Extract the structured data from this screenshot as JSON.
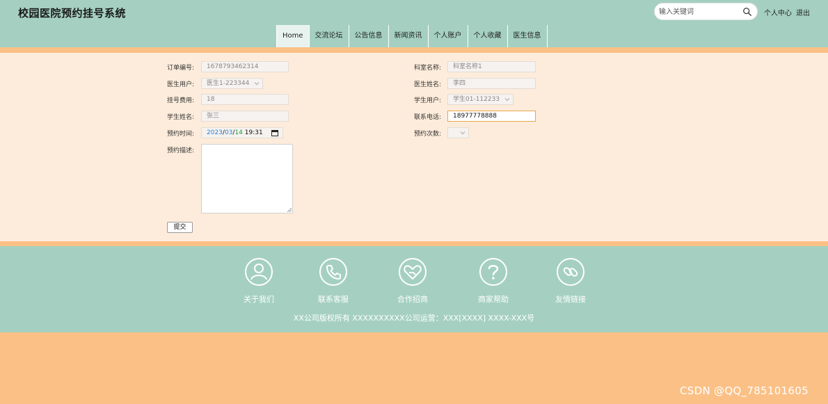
{
  "header": {
    "site_title": "校园医院预约挂号系统",
    "search_placeholder": "输入关键词",
    "personal_center": "个人中心",
    "logout": "退出"
  },
  "nav": {
    "items": [
      {
        "label": "Home",
        "active": true
      },
      {
        "label": "交流论坛"
      },
      {
        "label": "公告信息"
      },
      {
        "label": "新闻资讯"
      },
      {
        "label": "个人账户"
      },
      {
        "label": "个人收藏"
      },
      {
        "label": "医生信息"
      }
    ]
  },
  "form": {
    "order_no_label": "订单编号:",
    "order_no_value": "1678793462314",
    "doctor_user_label": "医生用户:",
    "doctor_user_value": "医生1-223344",
    "fee_label": "挂号费用:",
    "fee_value": "18",
    "student_name_label": "学生姓名:",
    "student_name_value": "张三",
    "appt_time_label": "预约时间:",
    "appt_year": "2023",
    "appt_month": "03",
    "appt_day": "14",
    "appt_clock": "19:31",
    "desc_label": "预约描述:",
    "dept_label": "科室名称:",
    "dept_value": "科室名称1",
    "doctor_name_label": "医生姓名:",
    "doctor_name_value": "李四",
    "student_user_label": "学生用户:",
    "student_user_value": "学生01-112233",
    "phone_label": "联系电话:",
    "phone_value": "18977778888",
    "count_label": "预约次数:",
    "count_value": "",
    "submit_label": "提交"
  },
  "footer": {
    "links": [
      {
        "label": "关于我们",
        "icon": "user-icon"
      },
      {
        "label": "联系客服",
        "icon": "phone-icon"
      },
      {
        "label": "合作招商",
        "icon": "handshake-heart-icon"
      },
      {
        "label": "商家帮助",
        "icon": "question-icon"
      },
      {
        "label": "友情链接",
        "icon": "link-icon"
      }
    ],
    "copyright": "XX公司版权所有 XXXXXXXXXX公司运营：XXX[XXXX] XXXX-XXX号"
  },
  "watermark": "CSDN @QQ_785101605",
  "colors": {
    "header_bg": "#a5d0c1",
    "accent_orange": "#fbc086",
    "form_bg": "#fdecdb"
  }
}
